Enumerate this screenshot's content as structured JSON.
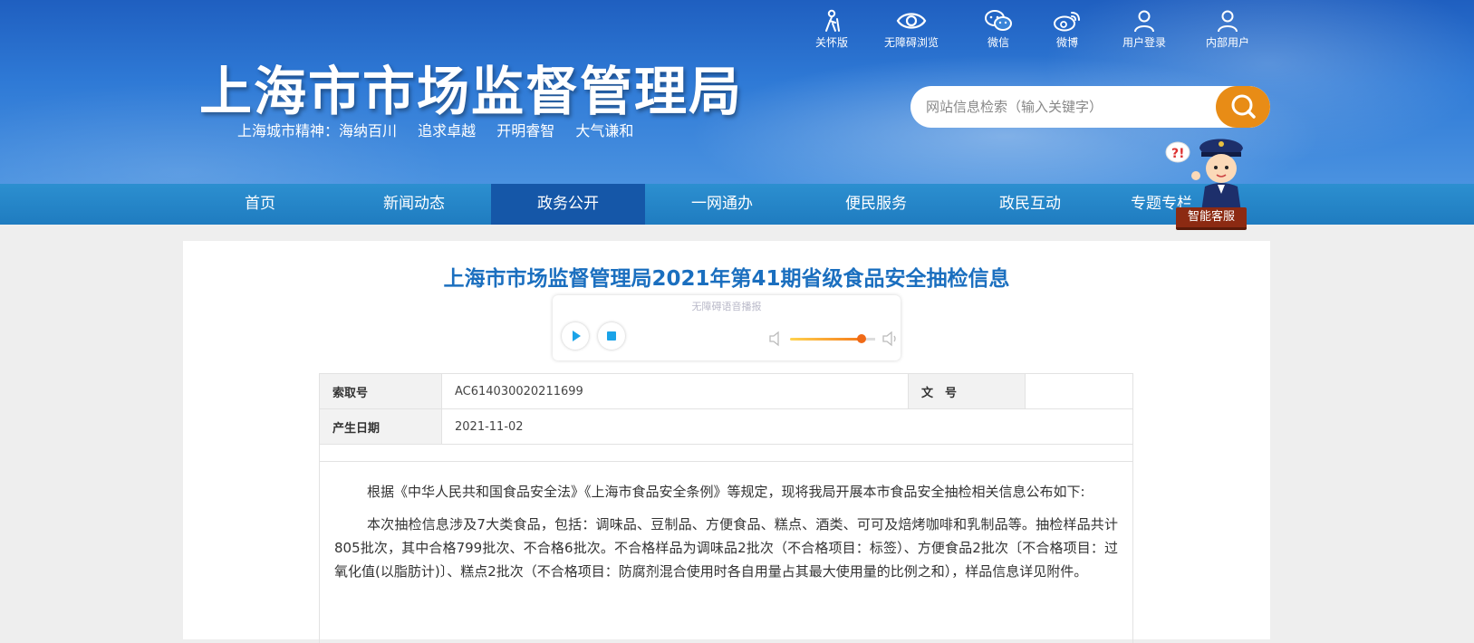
{
  "header": {
    "title": "上海市市场监督管理局",
    "slogan_prefix": "上海城市精神：",
    "slogan_items": [
      "海纳百川",
      "追求卓越",
      "开明睿智",
      "大气谦和"
    ],
    "quick_links": [
      {
        "label": "关怀版",
        "icon": "elder-care-icon"
      },
      {
        "label": "无障碍浏览",
        "icon": "eye-icon"
      },
      {
        "label": "微信",
        "icon": "wechat-icon"
      },
      {
        "label": "微博",
        "icon": "weibo-icon"
      },
      {
        "label": "用户登录",
        "icon": "user-icon"
      },
      {
        "label": "内部用户",
        "icon": "user-icon"
      }
    ],
    "search_placeholder": "网站信息检索（输入关键字）"
  },
  "nav": {
    "items": [
      "首页",
      "新闻动态",
      "政务公开",
      "一网通办",
      "便民服务",
      "政民互动",
      "专题专栏"
    ],
    "active": "政务公开"
  },
  "service": {
    "label": "智能客服"
  },
  "article": {
    "title": "上海市市场监督管理局2021年第41期省级食品安全抽检信息",
    "player_title": "无障碍语音播报",
    "volume_level": 0.85,
    "meta": {
      "index_label": "索取号",
      "index_value": "AC614030020211699",
      "doc_label": "文　号",
      "doc_value": "",
      "date_label": "产生日期",
      "date_value": "2021-11-02"
    },
    "paragraphs": [
      "根据《中华人民共和国食品安全法》《上海市食品安全条例》等规定，现将我局开展本市食品安全抽检相关信息公布如下:",
      "本次抽检信息涉及7大类食品，包括：调味品、豆制品、方便食品、糕点、酒类、可可及焙烤咖啡和乳制品等。抽检样品共计805批次，其中合格799批次、不合格6批次。不合格样品为调味品2批次（不合格项目：标签）、方便食品2批次〔不合格项目：过氧化值(以脂肪计)〕、糕点2批次（不合格项目：防腐剂混合使用时各自用量占其最大使用量的比例之和），样品信息详见附件。"
    ]
  },
  "colors": {
    "header_blue": "#2f7ad6",
    "nav_blue": "#1f7cc0",
    "nav_active": "#1557a8",
    "search_button": "#e88c16",
    "title_blue": "#1b6fbf"
  }
}
